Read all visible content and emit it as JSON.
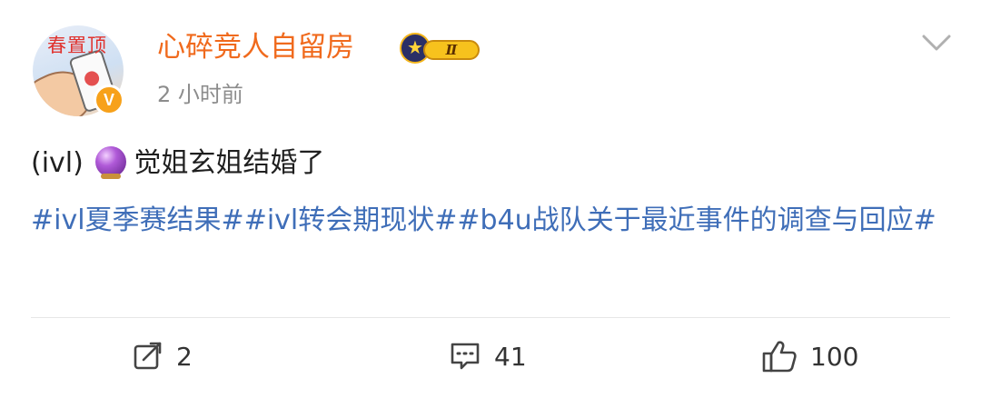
{
  "post": {
    "author": {
      "avatar_text": "春置顶",
      "verified_badge": "V",
      "name": "心碎竞人自留房",
      "level_badge": "Ⅱ"
    },
    "time": "2 小时前",
    "text_prefix": "(ivl)",
    "emoji": "crystal-ball",
    "text_suffix": "觉姐玄姐结婚了",
    "topics_text": "#ivl夏季赛结果##ivl转会期现状##b4u战队关于最近事件的调查与回应#",
    "actions": {
      "repost_icon": "repost-icon",
      "repost_count": "2",
      "comment_icon": "comment-icon",
      "comment_count": "41",
      "like_icon": "thumbs-up-icon",
      "like_count": "100"
    }
  },
  "colors": {
    "username": "#f06a1d",
    "topic": "#3f6eb8",
    "time": "#8c8c8c",
    "verified": "#f7a11a"
  }
}
